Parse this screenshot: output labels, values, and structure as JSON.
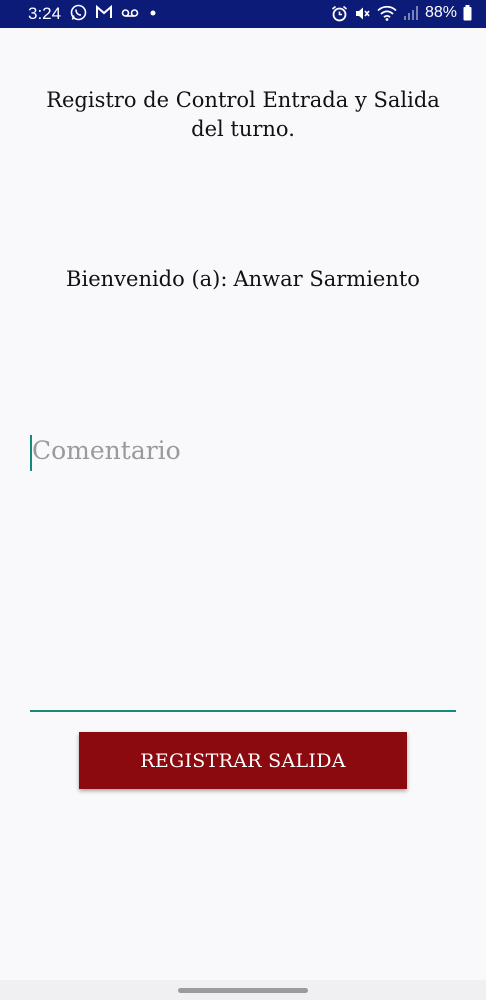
{
  "status_bar": {
    "time": "3:24",
    "battery": "88%",
    "icons": [
      "whatsapp-icon",
      "gmail-icon",
      "voicemail-icon",
      "dot-icon",
      "alarm-icon",
      "mute-icon",
      "wifi-icon",
      "signal-icon",
      "battery-icon"
    ],
    "background": "#0c1a78"
  },
  "title": "Registro de Control Entrada y Salida del turno.",
  "welcome": {
    "label": "Bienvenido (a):",
    "name": "Anwar Sarmiento"
  },
  "comment": {
    "placeholder": "Comentario",
    "value": ""
  },
  "button": {
    "label": "REGISTRAR SALIDA",
    "color": "#8b0a10"
  },
  "colors": {
    "accent": "#15897a",
    "background": "#f9f9fb"
  }
}
